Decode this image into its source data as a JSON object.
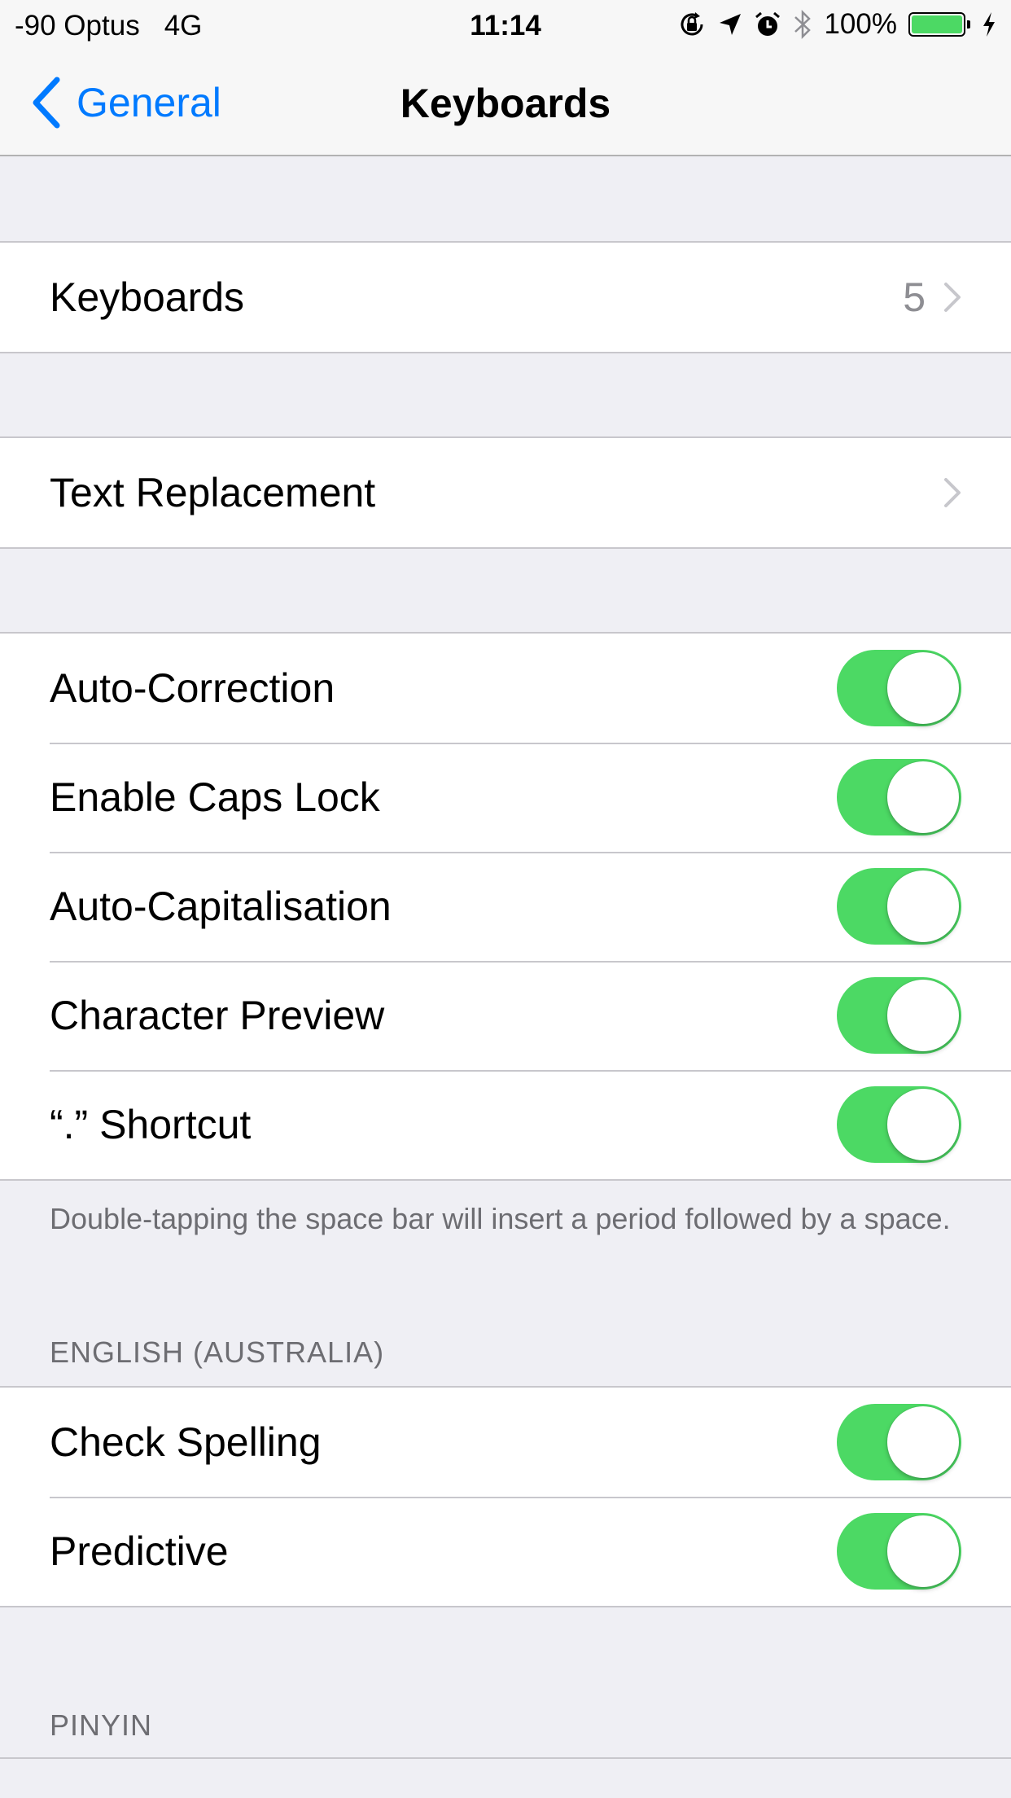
{
  "status_bar": {
    "signal": "-90 Optus",
    "network": "4G",
    "time": "11:14",
    "battery": "100%",
    "icons": [
      "orientation-lock-icon",
      "location-icon",
      "alarm-icon",
      "bluetooth-icon",
      "battery-icon",
      "charging-icon"
    ]
  },
  "nav": {
    "back_label": "General",
    "title": "Keyboards"
  },
  "keyboards_row": {
    "label": "Keyboards",
    "value": "5"
  },
  "text_replacement_row": {
    "label": "Text Replacement"
  },
  "typing_settings": [
    {
      "label": "Auto-Correction",
      "on": true
    },
    {
      "label": "Enable Caps Lock",
      "on": true
    },
    {
      "label": "Auto-Capitalisation",
      "on": true
    },
    {
      "label": "Character Preview",
      "on": true
    },
    {
      "label": "“.” Shortcut",
      "on": true
    }
  ],
  "shortcut_footer": "Double-tapping the space bar will insert a period followed by a space.",
  "english_section": {
    "header": "ENGLISH (AUSTRALIA)",
    "rows": [
      {
        "label": "Check Spelling",
        "on": true
      },
      {
        "label": "Predictive",
        "on": true
      }
    ]
  },
  "pinyin_section": {
    "header": "PINYIN"
  },
  "colors": {
    "accent": "#007aff",
    "toggle_on": "#4cd964",
    "background": "#efeff4",
    "secondary_text": "#6d6d72"
  }
}
